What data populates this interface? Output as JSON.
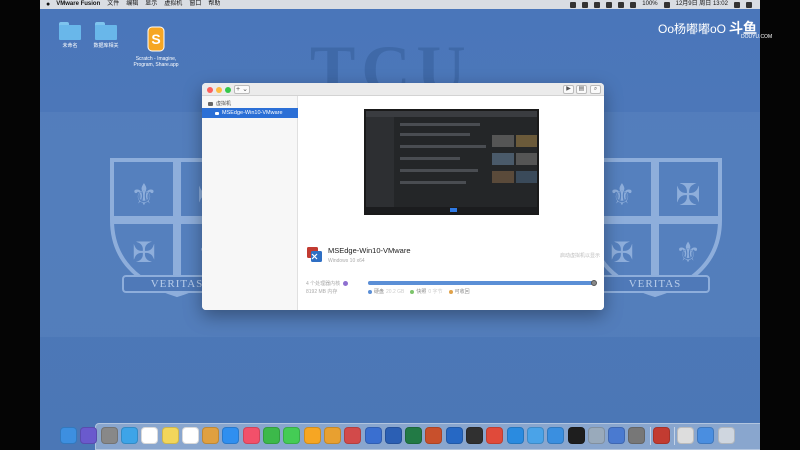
{
  "menubar": {
    "app_name": "VMware Fusion",
    "items": [
      "文件",
      "编辑",
      "显示",
      "虚拟机",
      "窗口",
      "帮助"
    ],
    "battery": "100%",
    "datetime": "12月9日 周日 13:02"
  },
  "desktop": {
    "wallpaper_text": "TCU",
    "motto": "VERITAS",
    "icons": [
      {
        "label": "未命名",
        "type": "folder"
      },
      {
        "label": "数据库相关",
        "type": "folder"
      },
      {
        "label": "Scratch - Imagine, Program, Share.app",
        "type": "app"
      }
    ]
  },
  "watermark": {
    "text": "Oo杨嘟嘟oO",
    "brand": "斗鱼",
    "sub": "DOUYU.COM"
  },
  "window": {
    "add_button": "+ ⌄",
    "sidebar": {
      "section": "虚拟机",
      "items": [
        {
          "label": "MSEdge-Win10-VMware",
          "selected": true
        }
      ]
    },
    "vm": {
      "name": "MSEdge-Win10-VMware",
      "os": "Windows 10 x64",
      "hint": "启动虚拟机以显示",
      "memory_label": "4 个处理器内核",
      "memory_size": "8192 MB 内存",
      "legend": [
        {
          "label": "硬盘",
          "value": "20.2 GB",
          "color": "#5b8fd6"
        },
        {
          "label": "快照",
          "value": "0 字节",
          "color": "#7cc46b"
        },
        {
          "label": "可收回",
          "value": "",
          "color": "#e0a24a"
        }
      ],
      "disk_usage_fraction": 0.99
    }
  },
  "colors": {
    "selection": "#2b6fd6",
    "wallpaper": "#4a76ba"
  }
}
